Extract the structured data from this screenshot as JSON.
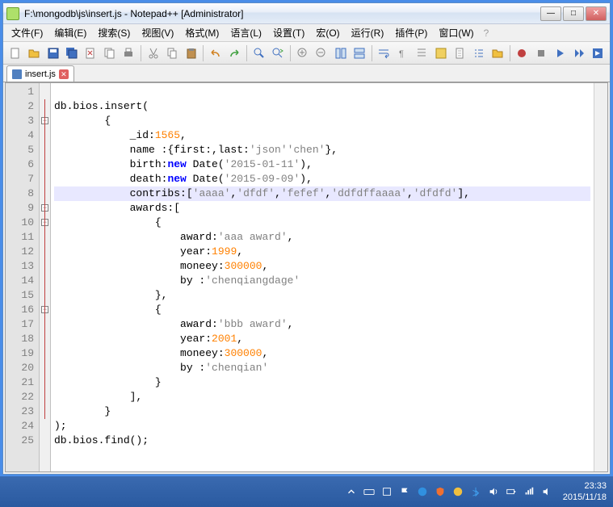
{
  "titlebar": {
    "title": "F:\\mongodb\\js\\insert.js - Notepad++ [Administrator]"
  },
  "menu": {
    "items": [
      "文件(F)",
      "编辑(E)",
      "搜索(S)",
      "视图(V)",
      "格式(M)",
      "语言(L)",
      "设置(T)",
      "宏(O)",
      "运行(R)",
      "插件(P)",
      "窗口(W)"
    ],
    "help": "?"
  },
  "tab": {
    "name": "insert.js"
  },
  "code": {
    "lines": [
      {
        "n": 1,
        "t": ""
      },
      {
        "n": 2,
        "t": "db.bios.insert("
      },
      {
        "n": 3,
        "t": "        {"
      },
      {
        "n": 4,
        "t": "            _id:",
        "num": "1565",
        "rest": ","
      },
      {
        "n": 5,
        "t": "            name :{first:",
        "str": "'json'",
        "mid": ",last:",
        "str2": "'chen'",
        "rest": "},"
      },
      {
        "n": 6,
        "t": "            birth:",
        "kw": "new",
        "mid": " Date(",
        "str": "'2015-01-11'",
        "rest": "),"
      },
      {
        "n": 7,
        "t": "            death:",
        "kw": "new",
        "mid": " Date(",
        "str": "'2015-09-09'",
        "rest": "),"
      },
      {
        "n": 8,
        "hl": true,
        "t": "            contribs:[",
        "str": "'aaaa'",
        "c": ",",
        "str2": "'dfdf'",
        "c2": ",",
        "str3": "'fefef'",
        "c3": ",",
        "str4": "'ddfdffaaaa'",
        "c4": ",",
        "str5": "'dfdfd'",
        "rest": "],"
      },
      {
        "n": 9,
        "t": "            awards:["
      },
      {
        "n": 10,
        "t": "                {"
      },
      {
        "n": 11,
        "t": "                    award:",
        "str": "'aaa award'",
        "rest": ","
      },
      {
        "n": 12,
        "t": "                    year:",
        "num": "1999",
        "rest": ","
      },
      {
        "n": 13,
        "t": "                    moneey:",
        "num": "300000",
        "rest": ","
      },
      {
        "n": 14,
        "t": "                    by :",
        "str": "'chenqiangdage'"
      },
      {
        "n": 15,
        "t": "                },"
      },
      {
        "n": 16,
        "t": "                {"
      },
      {
        "n": 17,
        "t": "                    award:",
        "str": "'bbb award'",
        "rest": ","
      },
      {
        "n": 18,
        "t": "                    year:",
        "num": "2001",
        "rest": ","
      },
      {
        "n": 19,
        "t": "                    moneey:",
        "num": "300000",
        "rest": ","
      },
      {
        "n": 20,
        "t": "                    by :",
        "str": "'chenqian'"
      },
      {
        "n": 21,
        "t": "                }"
      },
      {
        "n": 22,
        "t": "            ],"
      },
      {
        "n": 23,
        "t": "        }"
      },
      {
        "n": 24,
        "t": ");"
      },
      {
        "n": 25,
        "t": "db.bios.find();"
      }
    ],
    "caret_line": 8
  },
  "taskbar": {
    "time": "23:33",
    "date": "2015/11/18"
  }
}
